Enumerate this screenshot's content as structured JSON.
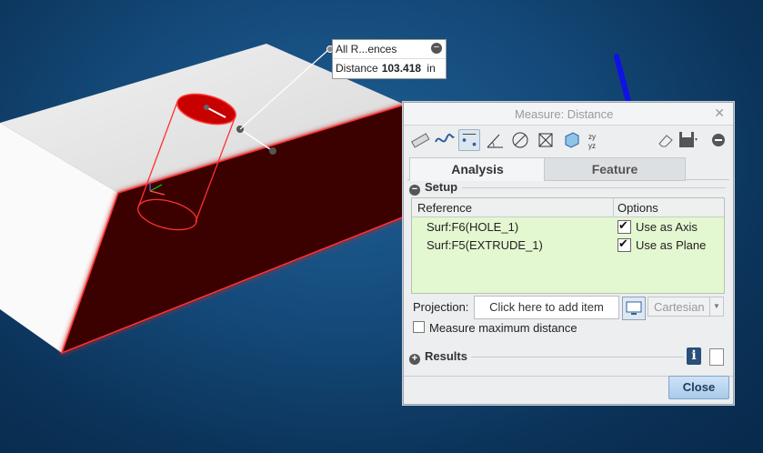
{
  "callout": {
    "title": "All R...ences",
    "distance_label": "Distance",
    "distance_value": "103.418",
    "distance_unit": "in"
  },
  "dialog": {
    "title": "Measure: Distance",
    "tabs": [
      "Analysis",
      "Feature"
    ],
    "setup": {
      "header": "Setup",
      "columns": [
        "Reference",
        "Options"
      ],
      "rows": [
        {
          "reference": "Surf:F6(HOLE_1)",
          "option": "Use as Axis",
          "checked": true
        },
        {
          "reference": "Surf:F5(EXTRUDE_1)",
          "option": "Use as Plane",
          "checked": true
        }
      ]
    },
    "projection": {
      "label": "Projection:",
      "button": "Click here to add item",
      "select": "Cartesian"
    },
    "max_distance": "Measure maximum distance",
    "results_header": "Results",
    "close": "Close"
  },
  "colors": {
    "background": "#144a7a",
    "highlight_face": "#3a0000",
    "highlight_edge": "#ff3030",
    "arrow": "#1010e8",
    "table_bg": "#e3f7d0"
  },
  "icons": [
    "ruler-icon",
    "curve-icon",
    "distance-icon",
    "angle-icon",
    "diameter-icon",
    "area-icon",
    "volume-icon",
    "transform-icon",
    "eraser-icon",
    "save-icon",
    "collapse-icon"
  ]
}
